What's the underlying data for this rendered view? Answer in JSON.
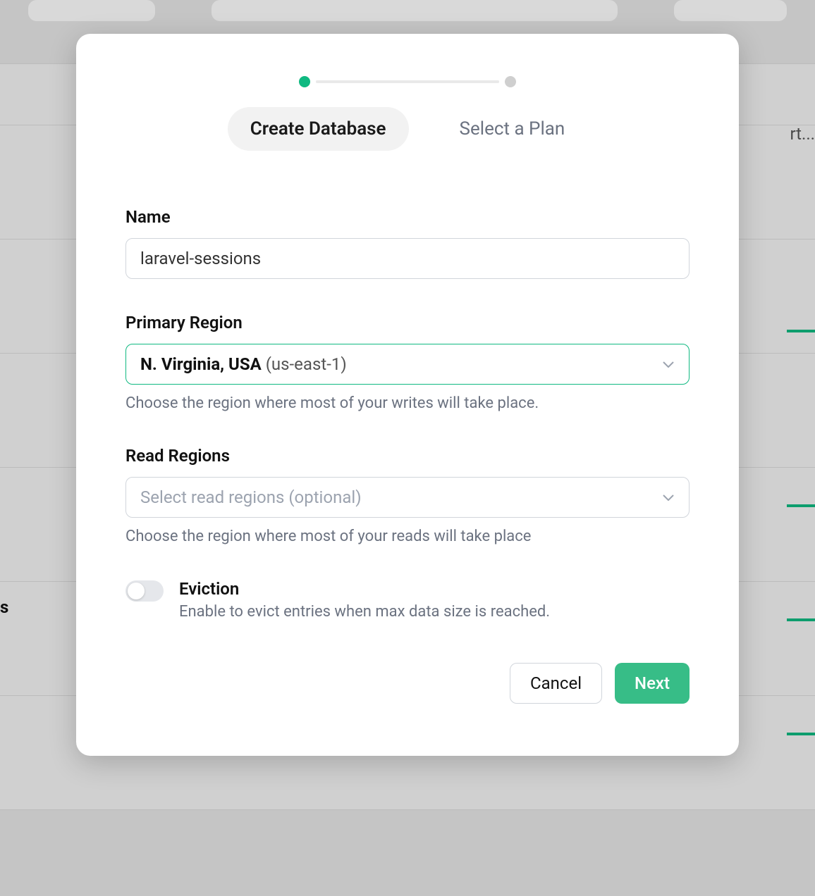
{
  "modal": {
    "tabs": {
      "create": "Create Database",
      "plan": "Select a Plan"
    },
    "name": {
      "label": "Name",
      "value": "laravel-sessions"
    },
    "primary_region": {
      "label": "Primary Region",
      "selected_name": "N. Virginia, USA",
      "selected_code": "(us-east-1)",
      "helper": "Choose the region where most of your writes will take place."
    },
    "read_regions": {
      "label": "Read Regions",
      "placeholder": "Select read regions (optional)",
      "helper": "Choose the region where most of your reads will take place"
    },
    "eviction": {
      "title": "Eviction",
      "description": "Enable to evict entries when max data size is reached."
    },
    "buttons": {
      "cancel": "Cancel",
      "next": "Next"
    }
  },
  "background": {
    "right_text": "rt...",
    "left_text": "s"
  }
}
